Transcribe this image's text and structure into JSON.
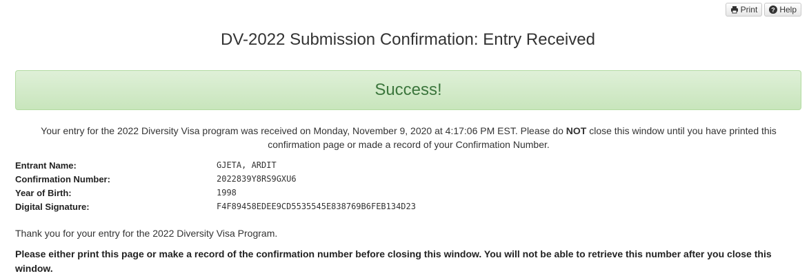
{
  "toolbar": {
    "print_label": "Print",
    "help_label": "Help",
    "print_icon": "printer-icon",
    "help_icon": "question-circle-icon"
  },
  "page_title": "DV-2022 Submission Confirmation: Entry Received",
  "alert": {
    "text": "Success!",
    "color": "#3c763d",
    "background": "#dff0d8"
  },
  "received": {
    "part1": "Your entry for the 2022 Diversity Visa program was received on Monday, November 9, 2020 at 4:17:06 PM EST. Please do ",
    "emphasis": "NOT",
    "part2": " close this window until you have printed this confirmation page or made a record of your Confirmation Number."
  },
  "details": [
    {
      "label": "Entrant Name:",
      "value": "GJETA, ARDIT"
    },
    {
      "label": "Confirmation Number:",
      "value": "2022839Y8RS9GXU6"
    },
    {
      "label": "Year of Birth:",
      "value": "1998"
    },
    {
      "label": "Digital Signature:",
      "value": "F4F89458EDEE9CD5535545E838769B6FEB134D23"
    }
  ],
  "thanks": "Thank you for your entry for the 2022 Diversity Visa Program.",
  "warning": "Please either print this page or make a record of the confirmation number before closing this window. You will not be able to retrieve this number after you close this window."
}
